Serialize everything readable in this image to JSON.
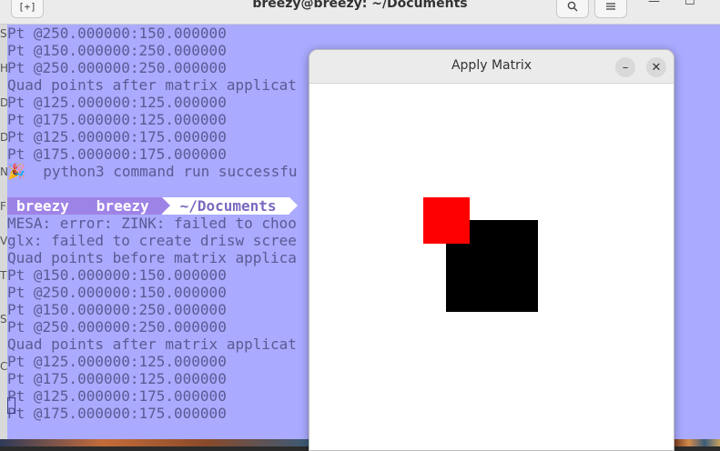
{
  "terminal": {
    "title": "breezy@breezy: ~/Documents",
    "new_tab_icon": "new-tab-icon",
    "left_strip_letters": [
      "S",
      "H",
      "D",
      "D",
      "N",
      "F",
      "V",
      "T",
      "S",
      "C"
    ],
    "lines_top": [
      "Pt @250.000000:150.000000",
      "Pt @150.000000:250.000000",
      "Pt @250.000000:250.000000",
      "Quad points after matrix applicat",
      "Pt @125.000000:125.000000",
      "Pt @175.000000:125.000000",
      "Pt @125.000000:175.000000",
      "Pt @175.000000:175.000000",
      "🎉  python3 command run successfu"
    ],
    "prompt": {
      "user": "breezy",
      "host": "breezy",
      "path": "~/Documents"
    },
    "lines_bottom": [
      "MESA: error: ZINK: failed to choo",
      "glx: failed to create drisw scree",
      "Quad points before matrix applica",
      "Pt @150.000000:150.000000",
      "Pt @250.000000:150.000000",
      "Pt @150.000000:250.000000",
      "Pt @250.000000:250.000000",
      "Quad points after matrix applicat",
      "Pt @125.000000:125.000000",
      "Pt @175.000000:125.000000",
      "Pt @125.000000:175.000000",
      "Pt @175.000000:175.000000"
    ],
    "background_color": "#aaaaff",
    "text_color": "#5a5a94"
  },
  "app_window": {
    "title": "Apply Matrix",
    "minimize_icon": "minimize-icon",
    "close_icon": "close-icon",
    "shapes": [
      {
        "name": "original-quad",
        "color": "#000000"
      },
      {
        "name": "transformed-quad",
        "color": "#ff0000"
      }
    ]
  }
}
